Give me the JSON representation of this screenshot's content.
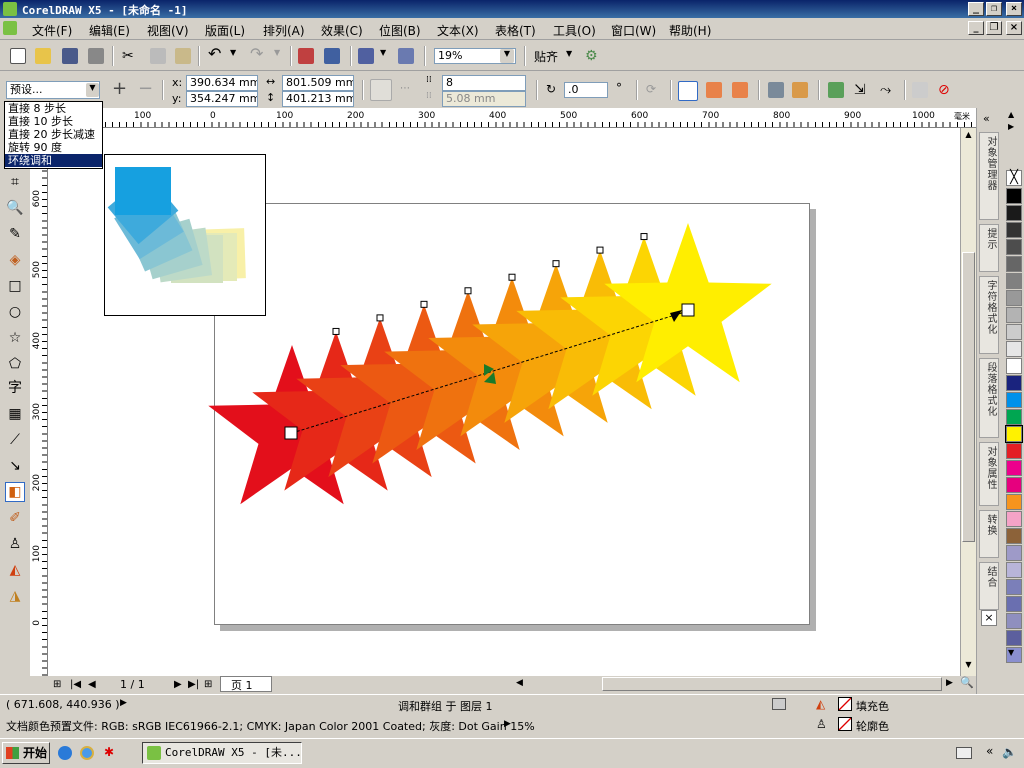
{
  "title": "CorelDRAW X5 - [未命名 -1]",
  "menus": [
    "文件(F)",
    "编辑(E)",
    "视图(V)",
    "版面(L)",
    "排列(A)",
    "效果(C)",
    "位图(B)",
    "文本(X)",
    "表格(T)",
    "工具(O)",
    "窗口(W)",
    "帮助(H)"
  ],
  "toolbar": {
    "zoom": "19%",
    "snap_label": "贴齐"
  },
  "propbar": {
    "preset": "预设...",
    "x": "390.634 mm",
    "y": "354.247 mm",
    "w": "801.509 mm",
    "h": "401.213 mm",
    "steps": "8",
    "spacing": "5.08 mm",
    "angle": ".0",
    "degree": "°",
    "x_label": "x:",
    "y_label": "y:"
  },
  "preset_menu": [
    "直接 8 步长",
    "直接 10 步长",
    "直接 20 步长减速",
    "旋转 90 度",
    "环绕调和"
  ],
  "preset_selected_index": 4,
  "ruler_h": [
    "100",
    "0",
    "100",
    "200",
    "300",
    "400",
    "500",
    "600",
    "700",
    "800",
    "900",
    "1000"
  ],
  "ruler_h_unit": "毫米",
  "ruler_v": [
    "600",
    "500",
    "400",
    "300",
    "200",
    "100",
    "0"
  ],
  "page_nav": {
    "counter": "1 / 1",
    "tab": "页 1"
  },
  "status": {
    "coords": "( 671.608, 440.936 )",
    "object_info": "调和群组 于 图层 1",
    "fill_label": "填充色",
    "outline_label": "轮廓色",
    "doc_info": "文档颜色预置文件: RGB: sRGB IEC61966-2.1; CMYK: Japan Color 2001 Coated; 灰度: Dot Gain 15%"
  },
  "taskbar": {
    "start": "开始",
    "task": "CorelDRAW X5 - [未..."
  },
  "dock_tabs": [
    "对象管理器",
    "提示",
    "字符格式化",
    "段落格式化",
    "对象属性",
    "转换",
    "结合"
  ],
  "palette": [
    "#ffffff",
    "#000000",
    "#1a1a1a",
    "#333333",
    "#4d4d4d",
    "#666666",
    "#808080",
    "#999999",
    "#b3b3b3",
    "#cccccc",
    "#e6e6e6",
    "#ffffff",
    "#1a237e",
    "#0091ea",
    "#00a651",
    "#fff200",
    "#e31e24",
    "#ec008c",
    "#e6007e",
    "#f7941d",
    "#f5a3c7",
    "#8c6239",
    "#9e9ac8",
    "#b8b4d9",
    "#7b7fb9",
    "#6a6fb0",
    "#8f8fbf",
    "#5c5f9e",
    "#8a8fcf"
  ],
  "blend": {
    "start_color": "#e30f1b",
    "end_color": "#ffee00",
    "steps": 8
  }
}
